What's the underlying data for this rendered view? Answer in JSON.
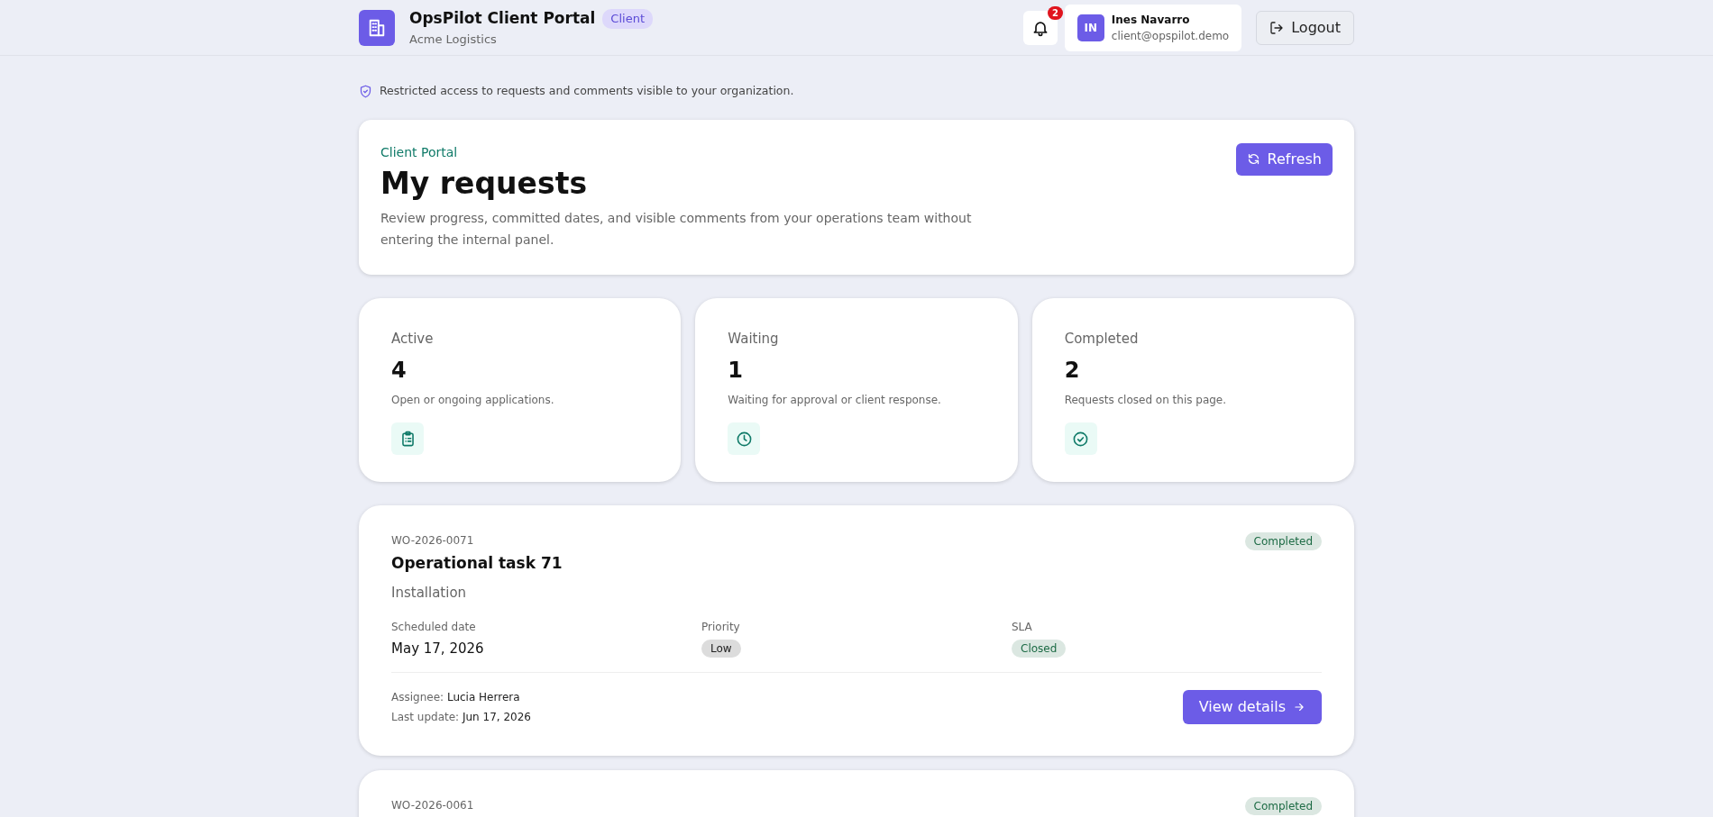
{
  "header": {
    "app_name": "OpsPilot Client Portal",
    "role_badge": "Client",
    "organization": "Acme Logistics",
    "notifications": {
      "count": "2"
    },
    "user": {
      "initials": "IN",
      "name": "Ines Navarro",
      "email": "client@opspilot.demo"
    },
    "logout": "Logout"
  },
  "notice": "Restricted access to requests and comments visible to your organization.",
  "hero": {
    "eyebrow": "Client Portal",
    "title": "My requests",
    "description": "Review progress, committed dates, and visible comments from your operations team without entering the internal panel.",
    "refresh": "Refresh"
  },
  "stats": [
    {
      "kind": "clipboard",
      "label": "Active",
      "value": "4",
      "caption": "Open or ongoing applications."
    },
    {
      "kind": "clock",
      "label": "Waiting",
      "value": "1",
      "caption": "Waiting for approval or client response."
    },
    {
      "kind": "check",
      "label": "Completed",
      "value": "2",
      "caption": "Requests closed on this page."
    }
  ],
  "requests": [
    {
      "code": "WO-2026-0071",
      "status": {
        "text": "Completed",
        "color": "#1d6b45"
      },
      "title": "Operational task 71",
      "category": "Installation",
      "fields": [
        {
          "kind": "text",
          "label": "Scheduled date",
          "value": "May 17, 2026"
        },
        {
          "kind": "badge",
          "label": "Priority",
          "value": "Low",
          "color": "#222222"
        },
        {
          "kind": "badge",
          "label": "SLA",
          "value": "Closed",
          "color": "#1d6b45"
        }
      ],
      "assignee_label": "Assignee:",
      "assignee": "Lucia Herrera",
      "update_label": "Last update:",
      "update": "Jun 17, 2026",
      "action": "View details"
    },
    {
      "code": "WO-2026-0061",
      "status": {
        "text": "Completed",
        "color": "#1d6b45"
      }
    }
  ]
}
